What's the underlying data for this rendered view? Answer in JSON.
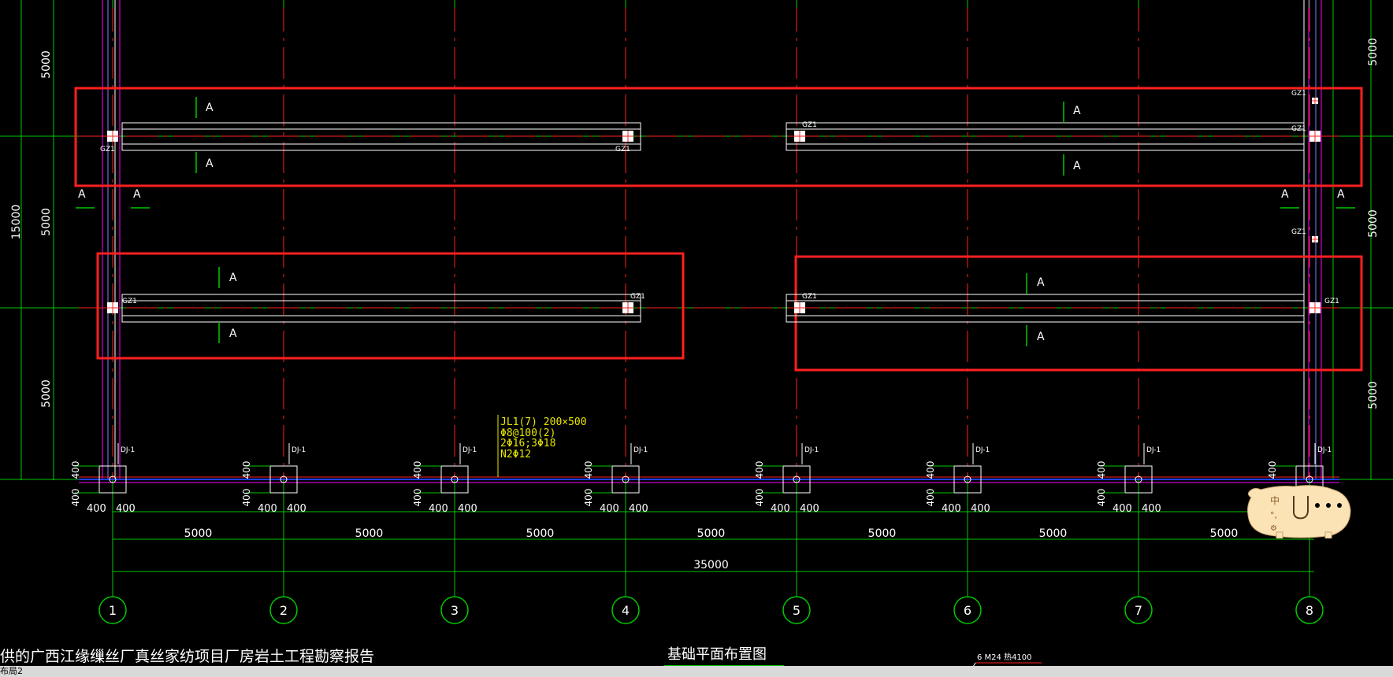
{
  "drawing": {
    "title_left": "供的广西江缘缫丝厂真丝家纺项目厂房岩土工程勘察报告",
    "plan_title": "基础平面布置图",
    "rebar_note": "6 M24 热4100",
    "layout_tab": "布局2"
  },
  "beam_note": {
    "line1": "JL1(7) 200×500",
    "line2": "Φ8@100(2)",
    "line3": "2Φ16;3Φ18",
    "line4": "N2Φ12"
  },
  "axis_labels": [
    "1",
    "2",
    "3",
    "4",
    "5",
    "6",
    "7",
    "8"
  ],
  "bay_dims": [
    "5000",
    "5000",
    "5000",
    "5000",
    "5000",
    "5000",
    "5000"
  ],
  "total_dim": "35000",
  "left_dims": {
    "top": "5000",
    "mid": "5000",
    "bottom": "5000",
    "total": "15000"
  },
  "right_dims": {
    "top": "5000",
    "mid": "5000",
    "bottom": "5000"
  },
  "footing_dim": "400",
  "footing_label": "DJ-1",
  "column_label": "GZ1",
  "section_mark": "A",
  "ime": {
    "line1": "中",
    "line2": "°,",
    "line3": "⚙"
  },
  "colors": {
    "red": "#ff2020",
    "green": "#00c800",
    "white": "#ffffff",
    "yellow": "#e6e600",
    "magenta": "#ff00ff",
    "blue": "#2040ff"
  }
}
